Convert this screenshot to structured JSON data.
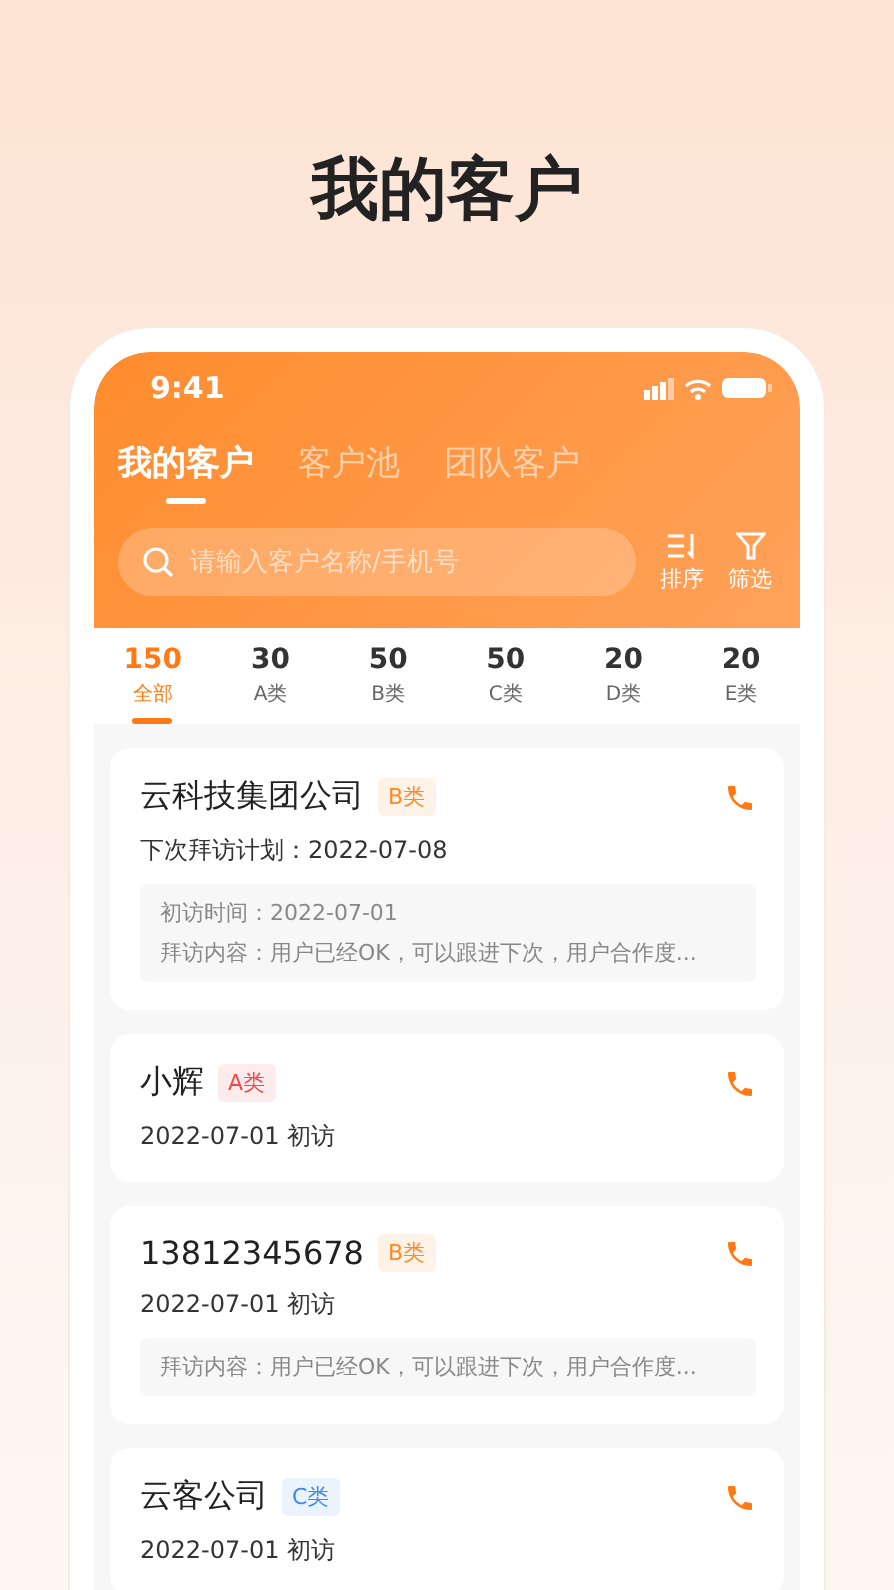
{
  "page_title": "我的客户",
  "status_bar": {
    "time": "9:41"
  },
  "tabs": [
    {
      "label": "我的客户",
      "selected": true
    },
    {
      "label": "客户池",
      "selected": false
    },
    {
      "label": "团队客户",
      "selected": false
    }
  ],
  "search": {
    "placeholder": "请输入客户名称/手机号"
  },
  "actions": [
    {
      "kind": "sort",
      "label": "排序"
    },
    {
      "kind": "filter",
      "label": "筛选"
    }
  ],
  "stats": [
    {
      "count": "150",
      "label": "全部",
      "selected": true
    },
    {
      "count": "30",
      "label": "A类",
      "selected": false
    },
    {
      "count": "50",
      "label": "B类",
      "selected": false
    },
    {
      "count": "50",
      "label": "C类",
      "selected": false
    },
    {
      "count": "20",
      "label": "D类",
      "selected": false
    },
    {
      "count": "20",
      "label": "E类",
      "selected": false
    }
  ],
  "customers": [
    {
      "name": "云科技集团公司",
      "tag": {
        "label": "B类",
        "color": "#ff8a1f"
      },
      "info": "下次拜访计划：2022-07-08",
      "details": [
        "初访时间：2022-07-01",
        "拜访内容：用户已经OK，可以跟进下次，用户合作度..."
      ]
    },
    {
      "name": "小辉",
      "tag": {
        "label": "A类",
        "color": "#f5464b"
      },
      "info": "2022-07-01 初访"
    },
    {
      "name": "13812345678",
      "tag": {
        "label": "B类",
        "color": "#ff8a1f"
      },
      "info": "2022-07-01 初访",
      "details": [
        "拜访内容：用户已经OK，可以跟进下次，用户合作度..."
      ]
    },
    {
      "name": "云客公司",
      "tag": {
        "label": "C类",
        "color": "#3d8bf5"
      },
      "info": "2022-07-01 初访"
    }
  ]
}
